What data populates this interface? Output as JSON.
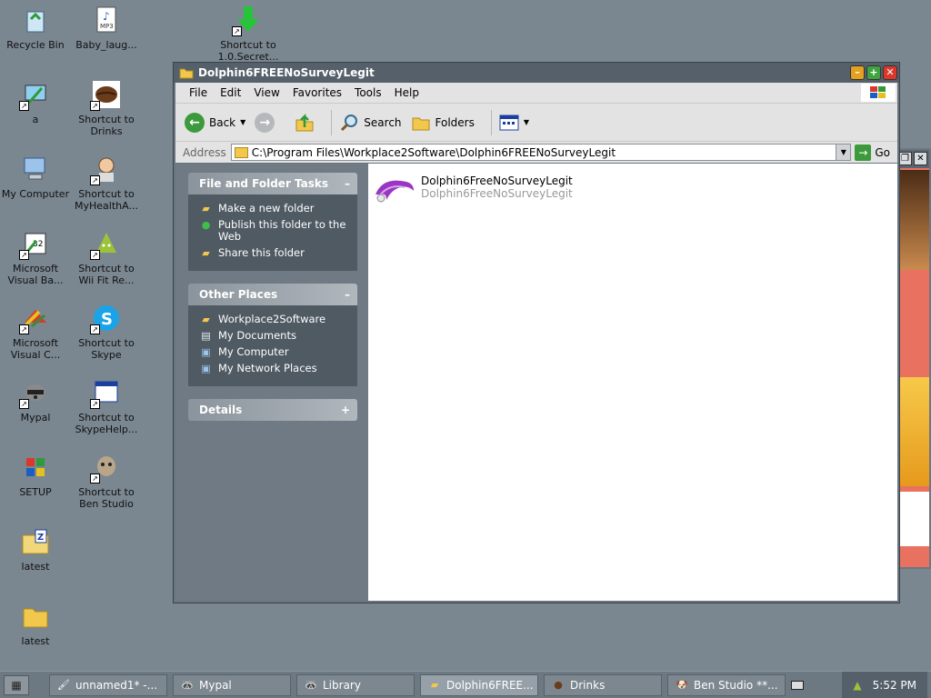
{
  "desktop_icons": [
    {
      "label": "Recycle Bin",
      "icon": "recycle-bin-icon",
      "shortcut": false
    },
    {
      "label": "Baby_laug...",
      "icon": "mp3-file-icon",
      "shortcut": false
    },
    {
      "label": "Shortcut to 1.0.Secret...",
      "icon": "download-arrow-icon",
      "shortcut": true
    },
    {
      "label": "a",
      "icon": "paint-icon",
      "shortcut": true
    },
    {
      "label": "Shortcut to Drinks",
      "icon": "coffee-bean-icon",
      "shortcut": true
    },
    {
      "label": "My Computer",
      "icon": "computer-icon",
      "shortcut": false
    },
    {
      "label": "Shortcut to MyHealthA...",
      "icon": "person-icon",
      "shortcut": true
    },
    {
      "label": "Microsoft Visual Ba...",
      "icon": "visual-basic-icon",
      "shortcut": true
    },
    {
      "label": "Shortcut to Wii Fit Re...",
      "icon": "android-icon",
      "shortcut": true
    },
    {
      "label": "Microsoft Visual C...",
      "icon": "visual-cpp-icon",
      "shortcut": true
    },
    {
      "label": "Shortcut to Skype",
      "icon": "skype-icon",
      "shortcut": true
    },
    {
      "label": "Mypal",
      "icon": "raccoon-icon",
      "shortcut": true
    },
    {
      "label": "Shortcut to SkypeHelp...",
      "icon": "window-icon",
      "shortcut": true
    },
    {
      "label": "SETUP",
      "icon": "windows-setup-icon",
      "shortcut": false
    },
    {
      "label": "Shortcut to Ben Studio",
      "icon": "dog-icon",
      "shortcut": true
    },
    {
      "label": "latest",
      "icon": "zip-folder-icon",
      "shortcut": false
    },
    {
      "label": "latest",
      "icon": "folder-icon",
      "shortcut": false
    }
  ],
  "window": {
    "title": "Dolphin6FREENoSurveyLegit",
    "menu": [
      "File",
      "Edit",
      "View",
      "Favorites",
      "Tools",
      "Help"
    ],
    "toolbar": {
      "back": "Back",
      "search": "Search",
      "folders": "Folders"
    },
    "address_label": "Address",
    "address_value": "C:\\Program Files\\Workplace2Software\\Dolphin6FREENoSurveyLegit",
    "go_label": "Go"
  },
  "tasks_panel": {
    "title": "File and Folder Tasks",
    "items": [
      "Make a new folder",
      "Publish this folder to the Web",
      "Share this folder"
    ]
  },
  "places_panel": {
    "title": "Other Places",
    "items": [
      "Workplace2Software",
      "My Documents",
      "My Computer",
      "My Network Places"
    ]
  },
  "details_panel": {
    "title": "Details"
  },
  "file_item": {
    "name": "Dolphin6FreeNoSurveyLegit",
    "description": "Dolphin6FreeNoSurveyLegit"
  },
  "taskbar": {
    "tasks": [
      "unnamed1* -...",
      "Mypal",
      "Library",
      "Dolphin6FREE...",
      "Drinks",
      "Ben Studio **..."
    ],
    "active_index": 3,
    "clock": "5:52 PM"
  }
}
